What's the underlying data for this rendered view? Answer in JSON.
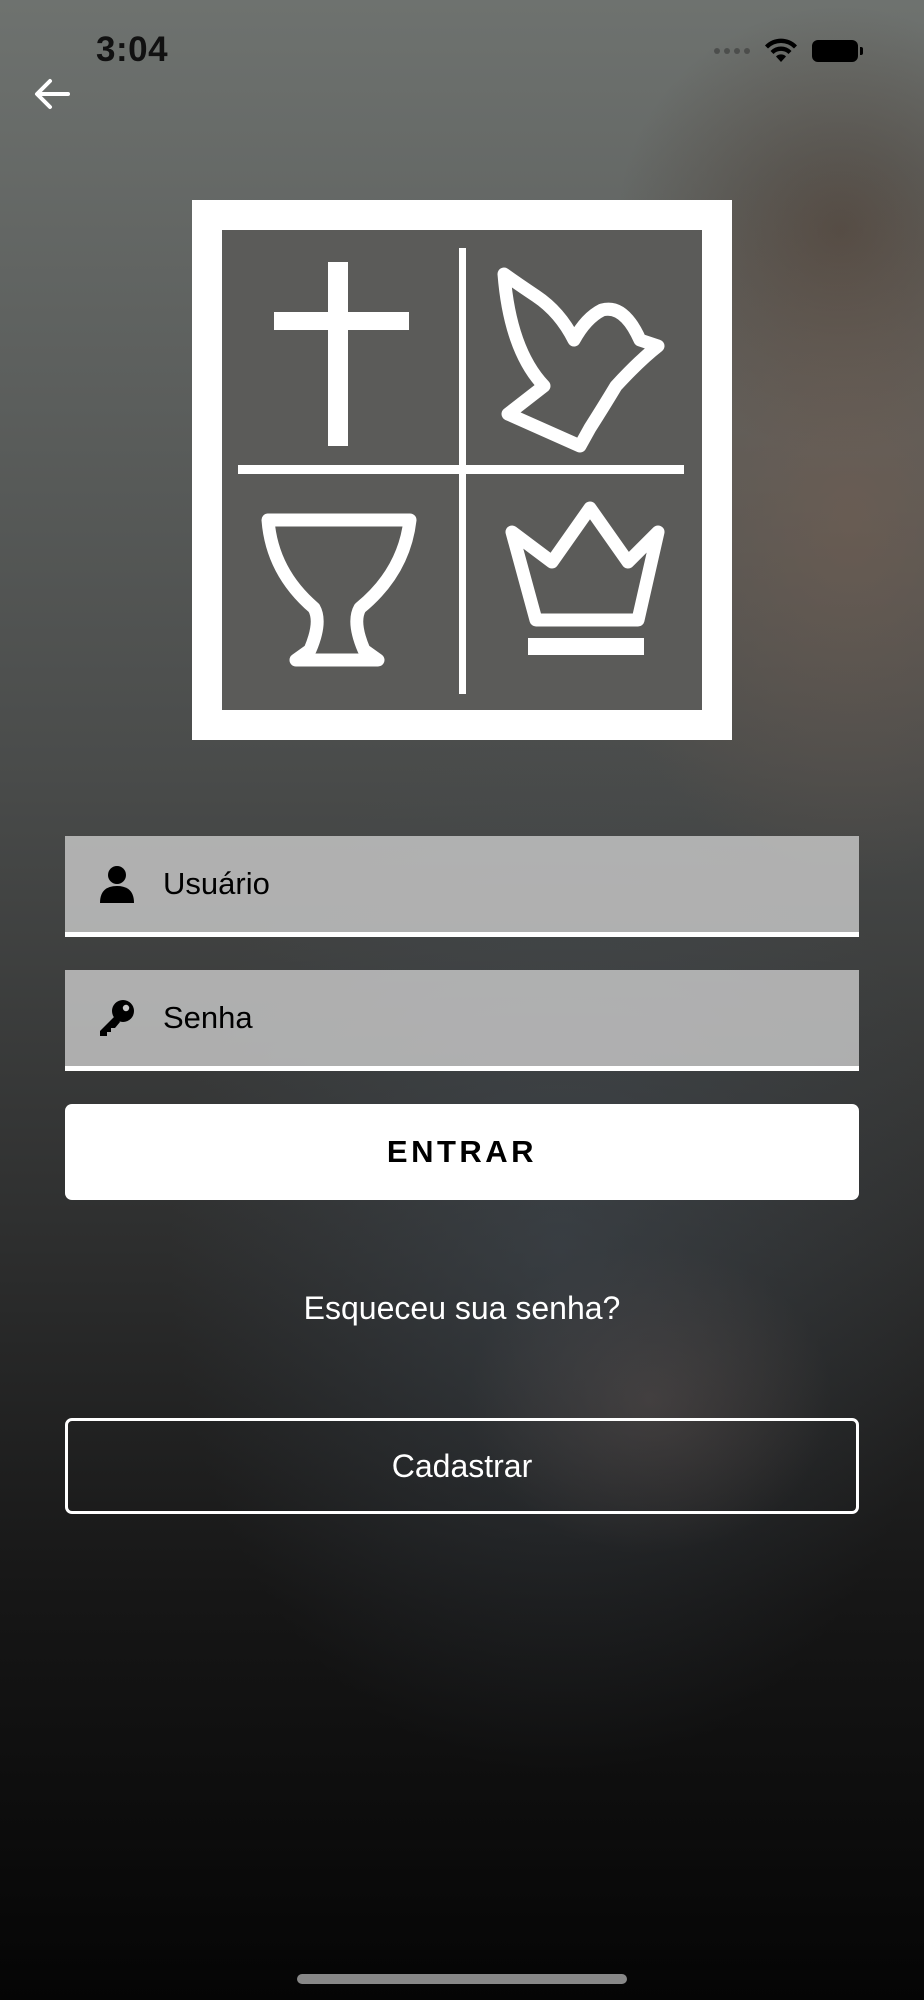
{
  "status_bar": {
    "time": "3:04"
  },
  "login_form": {
    "username_placeholder": "Usuário",
    "password_placeholder": "Senha",
    "submit_label": "ENTRAR",
    "forgot_password_label": "Esqueceu sua senha?",
    "register_label": "Cadastrar"
  },
  "icons": {
    "back": "arrow-left-icon",
    "user": "user-icon",
    "password": "key-icon",
    "wifi": "wifi-icon",
    "battery": "battery-icon",
    "logo_symbols": [
      "cross-icon",
      "dove-icon",
      "chalice-icon",
      "crown-icon"
    ]
  },
  "colors": {
    "primary_button_bg": "#ffffff",
    "primary_button_text": "#000000",
    "input_bg": "#c8c8c8",
    "text_light": "#ffffff"
  }
}
